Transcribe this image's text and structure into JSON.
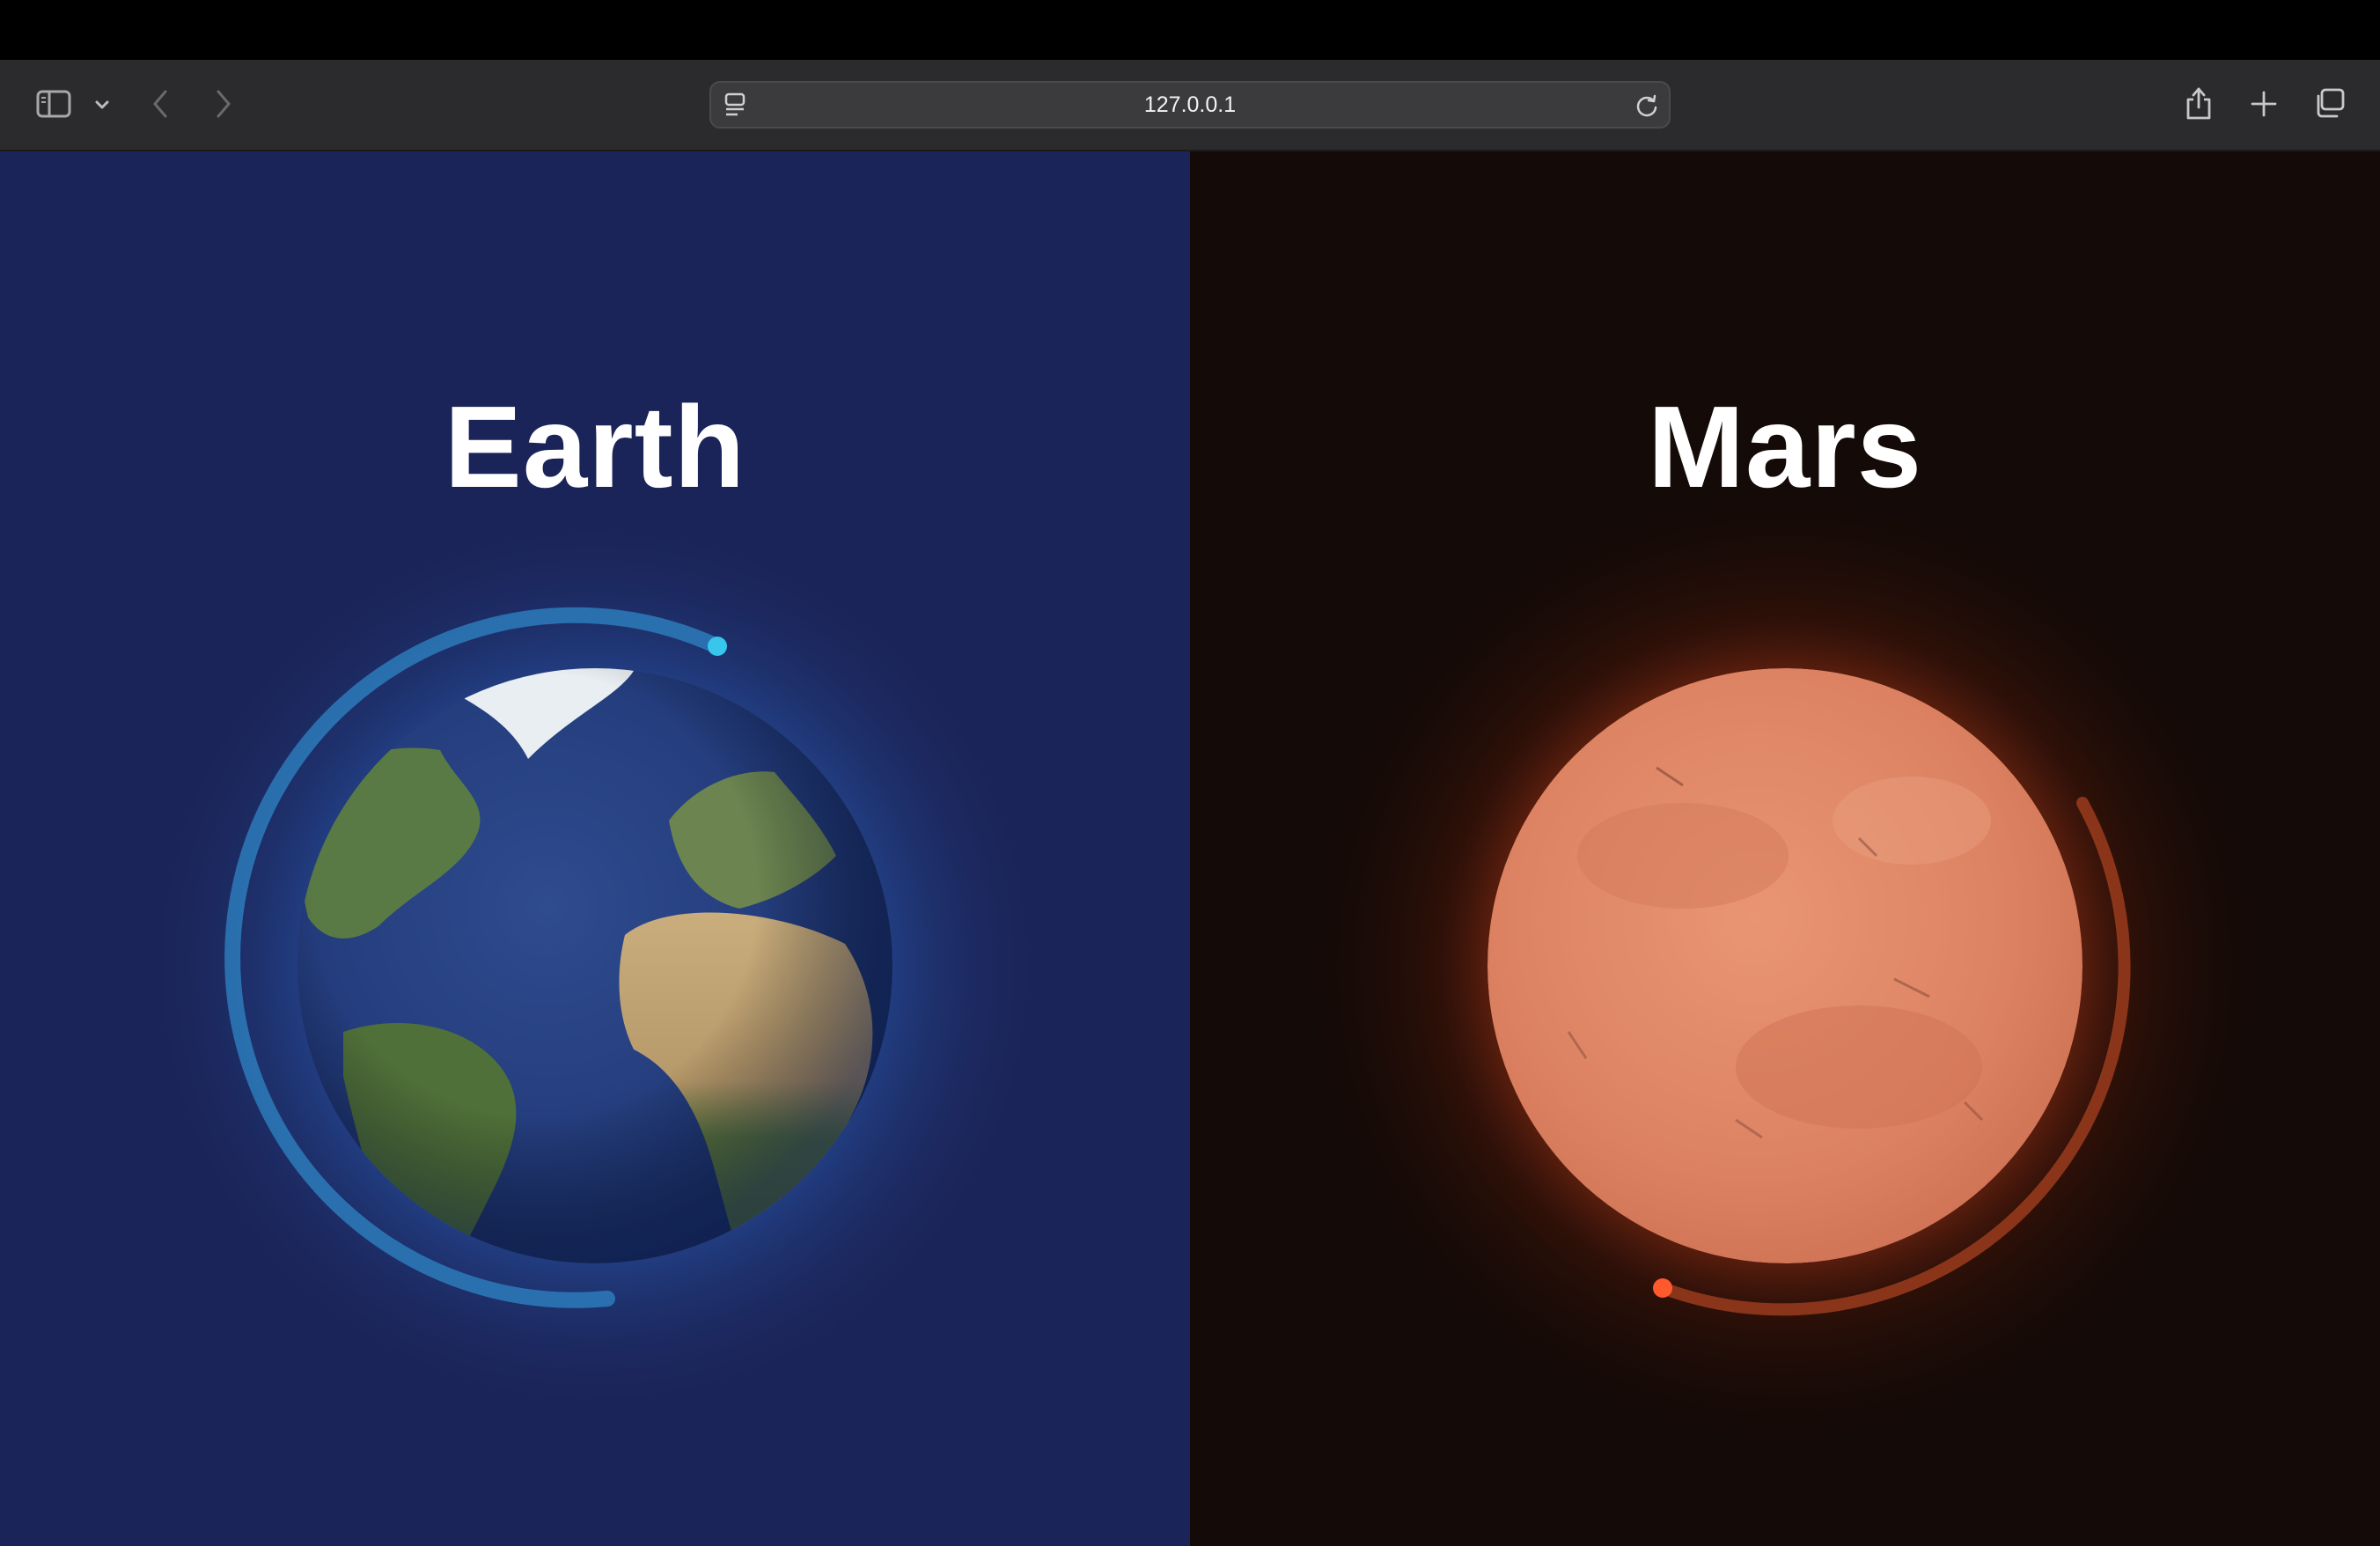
{
  "browser": {
    "url": "127.0.0.1",
    "icons": {
      "sidebar": "sidebar-icon",
      "sidebar_menu": "chevron-down-icon",
      "back": "chevron-left-icon",
      "forward": "chevron-right-icon",
      "page_menu": "page-menu-icon",
      "reload": "reload-icon",
      "share": "share-icon",
      "new_tab": "plus-icon",
      "tabs": "tabs-overview-icon"
    }
  },
  "panels": [
    {
      "title": "Earth",
      "background": "#1b2458",
      "accent": "#37c6ec",
      "image": "earth-globe"
    },
    {
      "title": "Mars",
      "background": "#140a07",
      "accent": "#ff5a2e",
      "image": "mars-globe"
    }
  ]
}
